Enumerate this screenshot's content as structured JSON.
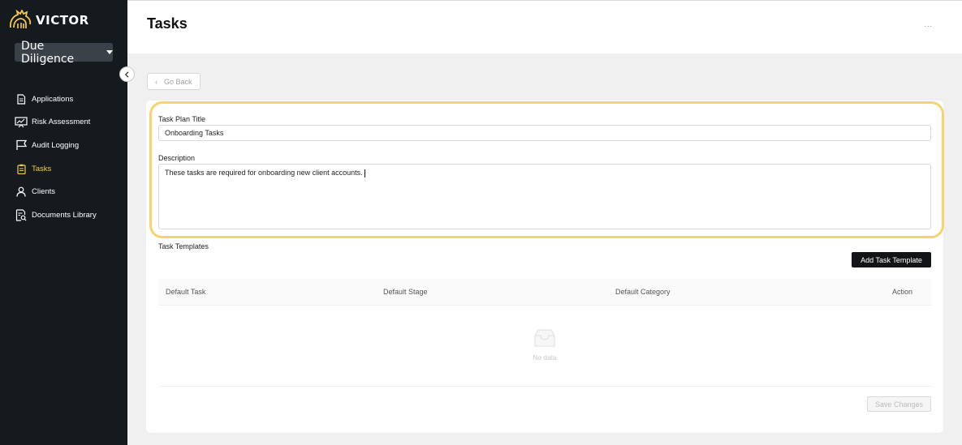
{
  "app": {
    "brand": "VICTOR",
    "module": "Due Diligence"
  },
  "sidebar": {
    "items": [
      {
        "label": "Applications",
        "icon": "document-icon"
      },
      {
        "label": "Risk Assessment",
        "icon": "chart-board-icon"
      },
      {
        "label": "Audit Logging",
        "icon": "flag-icon"
      },
      {
        "label": "Tasks",
        "icon": "clipboard-icon",
        "active": true
      },
      {
        "label": "Clients",
        "icon": "user-icon"
      },
      {
        "label": "Documents Library",
        "icon": "document-search-icon"
      }
    ]
  },
  "header": {
    "title": "Tasks",
    "more": "..."
  },
  "go_back": {
    "label": "Go Back"
  },
  "form": {
    "title_label": "Task Plan Title",
    "title_value": "Onboarding Tasks",
    "description_label": "Description",
    "description_value": "These tasks are required for onboarding new client accounts."
  },
  "templates": {
    "section_label": "Task Templates",
    "add_button": "Add Task Template",
    "columns": [
      "Default Task",
      "Default Stage",
      "Default Category",
      "Action"
    ],
    "rows": [],
    "empty_text": "No data"
  },
  "save_button": "Save Changes",
  "colors": {
    "sidebar_bg": "#151a1f",
    "accent": "#f5c94a",
    "highlight": "#f5d36e",
    "primary_button": "#121417"
  }
}
